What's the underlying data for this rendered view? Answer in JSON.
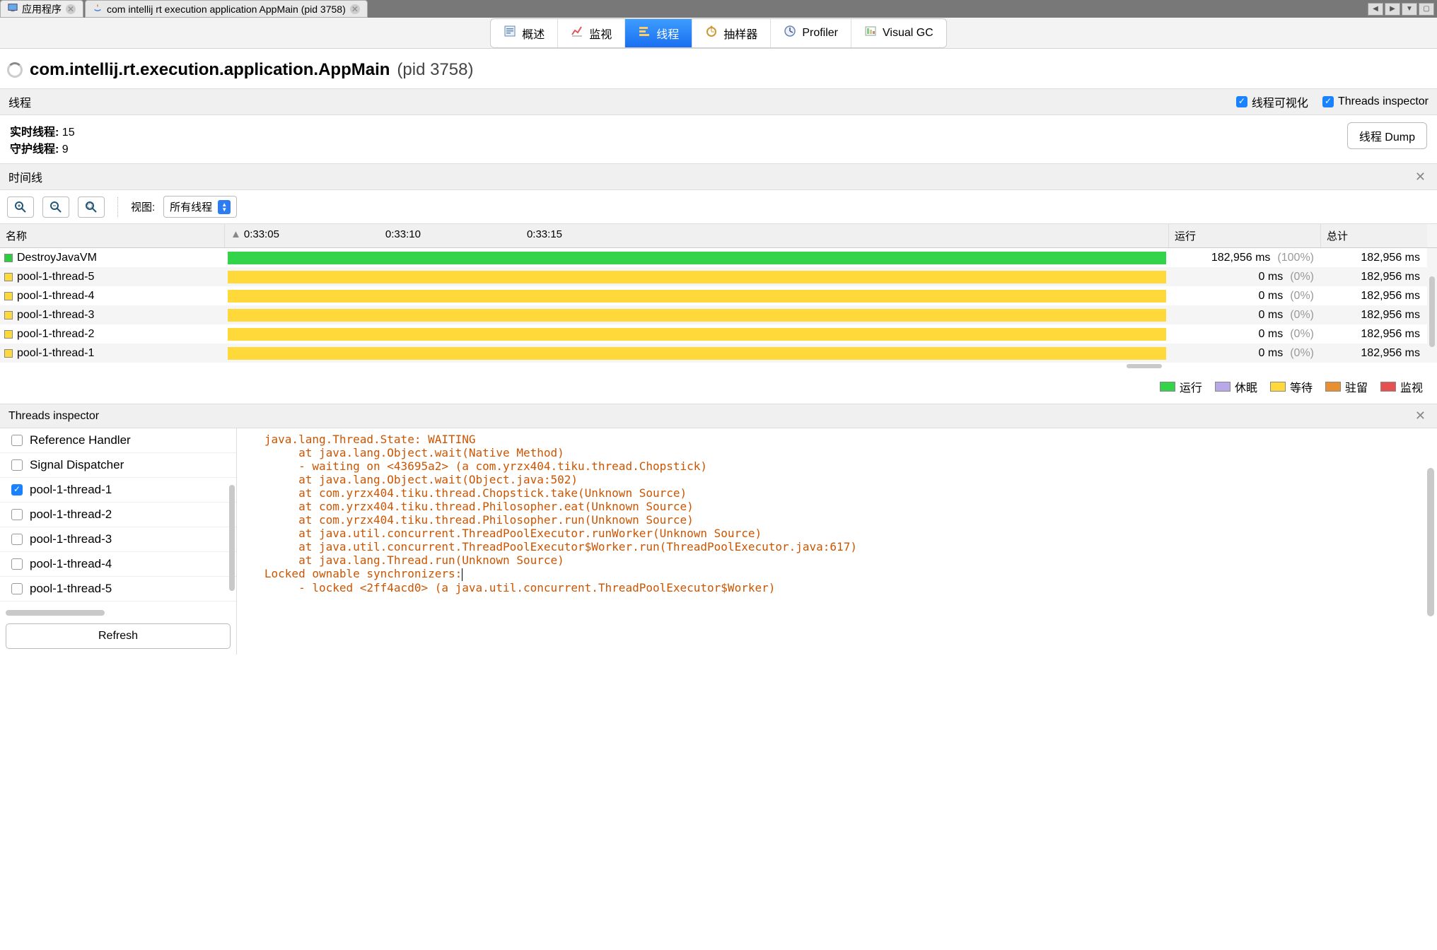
{
  "tabs": {
    "app_tab": "应用程序",
    "main_tab": "com intellij rt execution application AppMain (pid 3758)"
  },
  "subtabs": {
    "overview": "概述",
    "monitor": "监视",
    "threads": "线程",
    "sampler": "抽样器",
    "profiler": "Profiler",
    "visualgc": "Visual GC"
  },
  "title": {
    "app_name": "com.intellij.rt.execution.application.AppMain",
    "pid": "(pid 3758)"
  },
  "sections": {
    "threads_label": "线程",
    "visualize_label": "线程可视化",
    "inspector_label": "Threads inspector",
    "timeline_label": "时间线",
    "inspector_title": "Threads inspector"
  },
  "stats": {
    "live_label": "实时线程:",
    "live_value": "15",
    "daemon_label": "守护线程:",
    "daemon_value": "9",
    "dump_btn": "线程 Dump"
  },
  "toolbar": {
    "view_label": "视图:",
    "view_value": "所有线程"
  },
  "table_headers": {
    "name": "名称",
    "run": "运行",
    "total": "总计",
    "time1": "0:33:05",
    "time2": "0:33:10",
    "time3": "0:33:15"
  },
  "threads": [
    {
      "name": "DestroyJavaVM",
      "color": "green",
      "run": "182,956 ms",
      "pct": "(100%)",
      "total": "182,956 ms"
    },
    {
      "name": "pool-1-thread-5",
      "color": "yellow",
      "run": "0 ms",
      "pct": "(0%)",
      "total": "182,956 ms"
    },
    {
      "name": "pool-1-thread-4",
      "color": "yellow",
      "run": "0 ms",
      "pct": "(0%)",
      "total": "182,956 ms"
    },
    {
      "name": "pool-1-thread-3",
      "color": "yellow",
      "run": "0 ms",
      "pct": "(0%)",
      "total": "182,956 ms"
    },
    {
      "name": "pool-1-thread-2",
      "color": "yellow",
      "run": "0 ms",
      "pct": "(0%)",
      "total": "182,956 ms"
    },
    {
      "name": "pool-1-thread-1",
      "color": "yellow",
      "run": "0 ms",
      "pct": "(0%)",
      "total": "182,956 ms"
    }
  ],
  "legend": {
    "run": "运行",
    "sleep": "休眠",
    "wait": "等待",
    "park": "驻留",
    "monitor": "监视"
  },
  "inspector_list": [
    {
      "label": "Reference Handler",
      "checked": false
    },
    {
      "label": "Signal Dispatcher",
      "checked": false
    },
    {
      "label": "pool-1-thread-1",
      "checked": true
    },
    {
      "label": "pool-1-thread-2",
      "checked": false
    },
    {
      "label": "pool-1-thread-3",
      "checked": false
    },
    {
      "label": "pool-1-thread-4",
      "checked": false
    },
    {
      "label": "pool-1-thread-5",
      "checked": false
    }
  ],
  "refresh_btn": "Refresh",
  "stack_lines": [
    "   java.lang.Thread.State: WAITING",
    "        at java.lang.Object.wait(Native Method)",
    "        - waiting on <43695a2> (a com.yrzx404.tiku.thread.Chopstick)",
    "        at java.lang.Object.wait(Object.java:502)",
    "        at com.yrzx404.tiku.thread.Chopstick.take(Unknown Source)",
    "        at com.yrzx404.tiku.thread.Philosopher.eat(Unknown Source)",
    "        at com.yrzx404.tiku.thread.Philosopher.run(Unknown Source)",
    "        at java.util.concurrent.ThreadPoolExecutor.runWorker(Unknown Source)",
    "        at java.util.concurrent.ThreadPoolExecutor$Worker.run(ThreadPoolExecutor.java:617)",
    "        at java.lang.Thread.run(Unknown Source)",
    "",
    "   Locked ownable synchronizers:",
    "        - locked <2ff4acd0> (a java.util.concurrent.ThreadPoolExecutor$Worker)"
  ]
}
